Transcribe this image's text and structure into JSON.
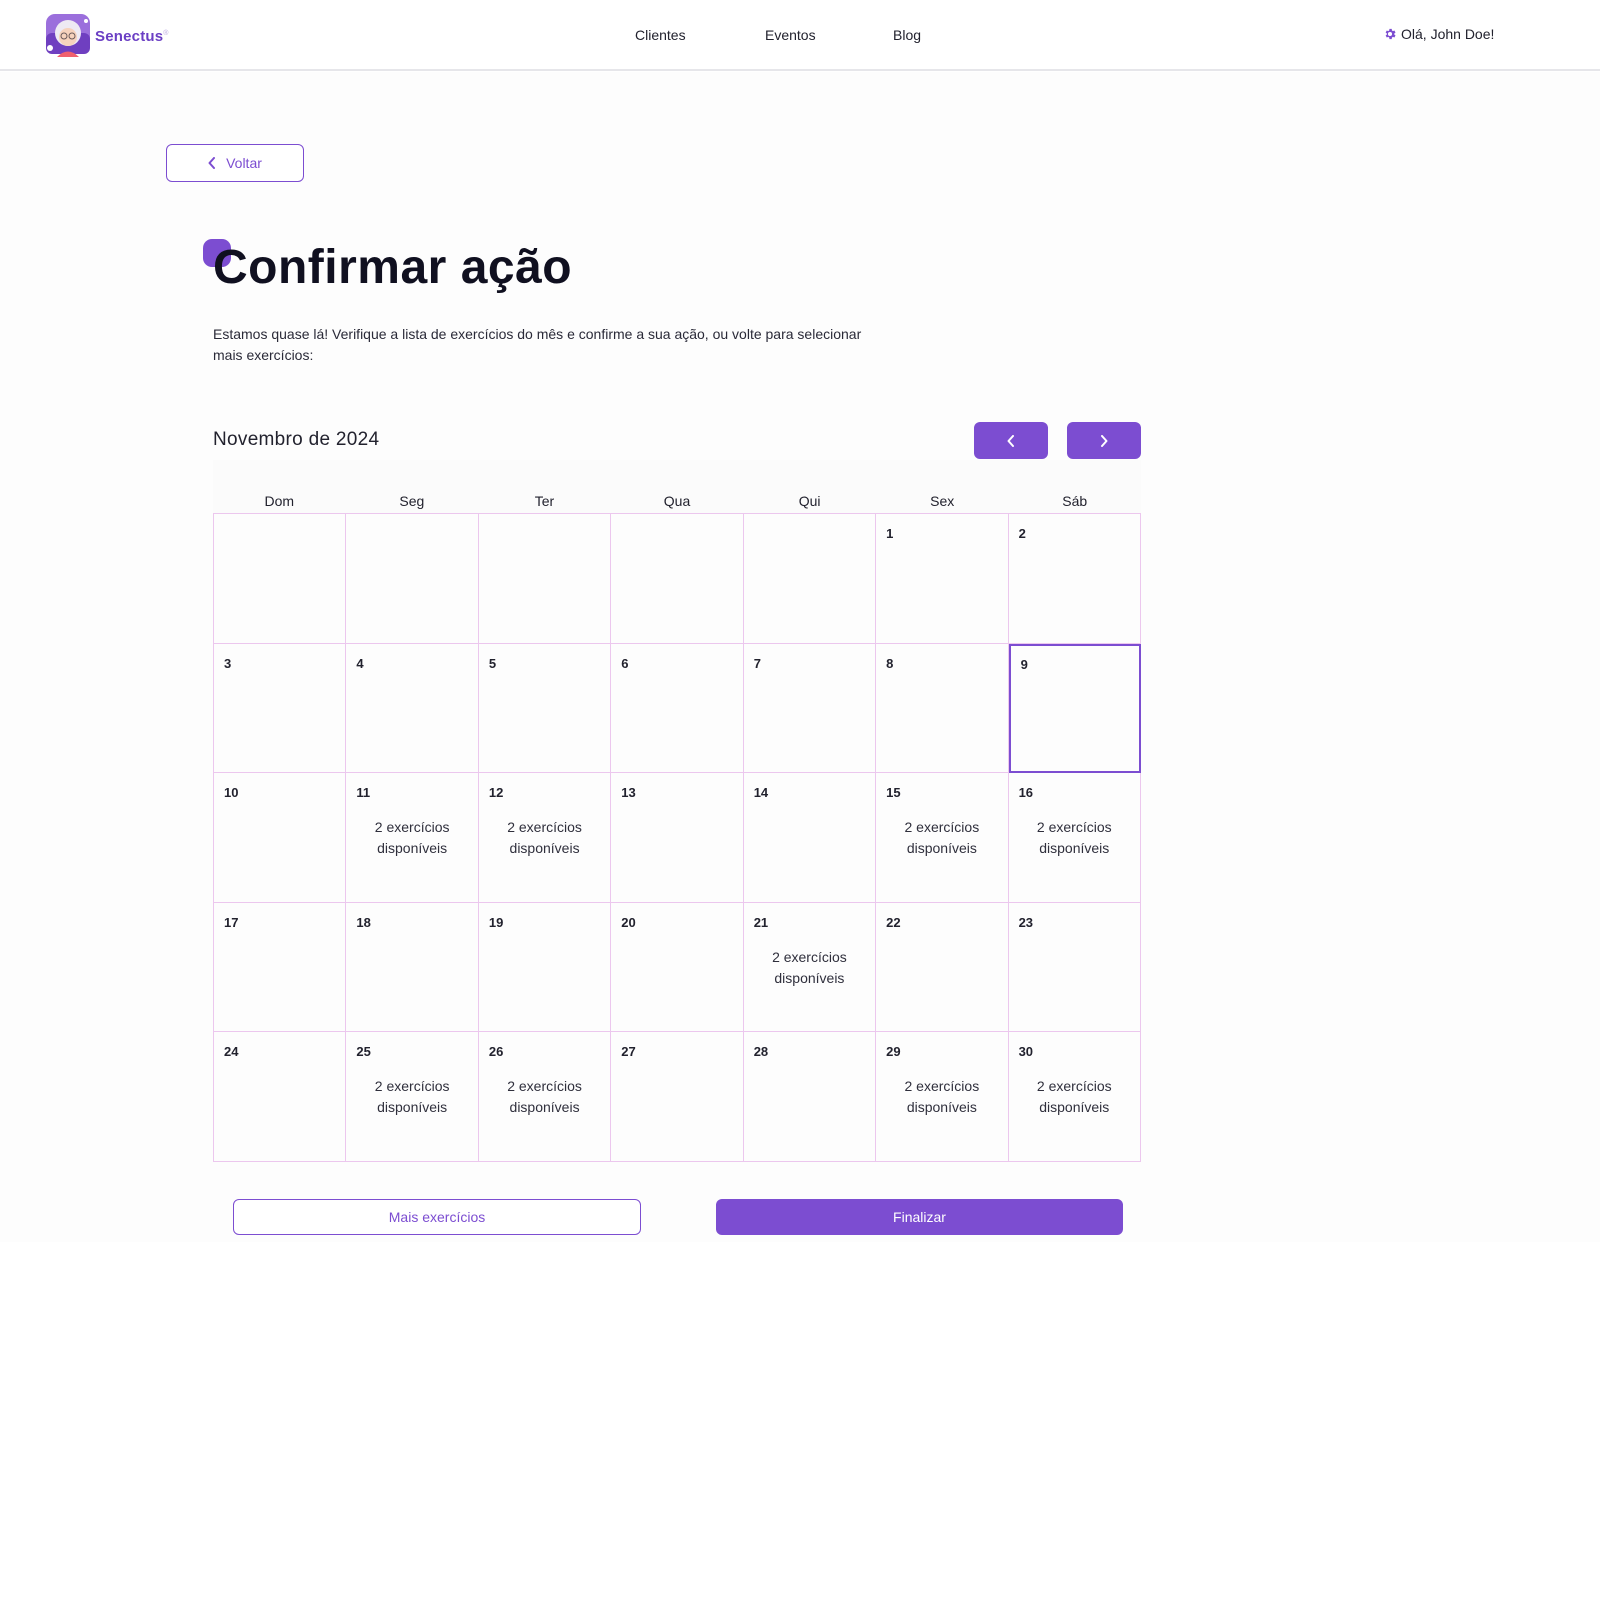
{
  "brand": {
    "name": "Senectus",
    "mark": "®",
    "accent": "#7c4dd1"
  },
  "nav": {
    "clients": "Clientes",
    "events": "Eventos",
    "blog": "Blog"
  },
  "user": {
    "greeting": "Olá, John Doe!",
    "icon": "gear-icon"
  },
  "back": {
    "label": "Voltar",
    "icon": "chevron-left-icon"
  },
  "page": {
    "title": "Confirmar ação",
    "description": "Estamos quase lá! Verifique a lista de exercícios do mês e confirme a sua ação, ou volte para selecionar mais exercícios:"
  },
  "calendar": {
    "month_label": "Novembro de 2024",
    "prev_icon": "chevron-left-icon",
    "next_icon": "chevron-right-icon",
    "weekdays": [
      "Dom",
      "Seg",
      "Ter",
      "Qua",
      "Qui",
      "Sex",
      "Sáb"
    ],
    "selected_day": "9",
    "days": [
      {
        "d": "",
        "a": ""
      },
      {
        "d": "",
        "a": ""
      },
      {
        "d": "",
        "a": ""
      },
      {
        "d": "",
        "a": ""
      },
      {
        "d": "",
        "a": ""
      },
      {
        "d": "1",
        "a": ""
      },
      {
        "d": "2",
        "a": ""
      },
      {
        "d": "3",
        "a": ""
      },
      {
        "d": "4",
        "a": ""
      },
      {
        "d": "5",
        "a": ""
      },
      {
        "d": "6",
        "a": ""
      },
      {
        "d": "7",
        "a": ""
      },
      {
        "d": "8",
        "a": ""
      },
      {
        "d": "9",
        "a": ""
      },
      {
        "d": "10",
        "a": ""
      },
      {
        "d": "11",
        "a": "2 exercícios disponíveis"
      },
      {
        "d": "12",
        "a": "2 exercícios disponíveis"
      },
      {
        "d": "13",
        "a": ""
      },
      {
        "d": "14",
        "a": ""
      },
      {
        "d": "15",
        "a": "2 exercícios disponíveis"
      },
      {
        "d": "16",
        "a": "2 exercícios disponíveis"
      },
      {
        "d": "17",
        "a": ""
      },
      {
        "d": "18",
        "a": ""
      },
      {
        "d": "19",
        "a": ""
      },
      {
        "d": "20",
        "a": ""
      },
      {
        "d": "21",
        "a": "2 exercícios disponíveis"
      },
      {
        "d": "22",
        "a": ""
      },
      {
        "d": "23",
        "a": ""
      },
      {
        "d": "24",
        "a": ""
      },
      {
        "d": "25",
        "a": "2 exercícios disponíveis"
      },
      {
        "d": "26",
        "a": "2 exercícios disponíveis"
      },
      {
        "d": "27",
        "a": ""
      },
      {
        "d": "28",
        "a": ""
      },
      {
        "d": "29",
        "a": "2 exercícios disponíveis"
      },
      {
        "d": "30",
        "a": "2 exercícios disponíveis"
      }
    ]
  },
  "actions": {
    "more": "Mais exercícios",
    "finish": "Finalizar"
  }
}
